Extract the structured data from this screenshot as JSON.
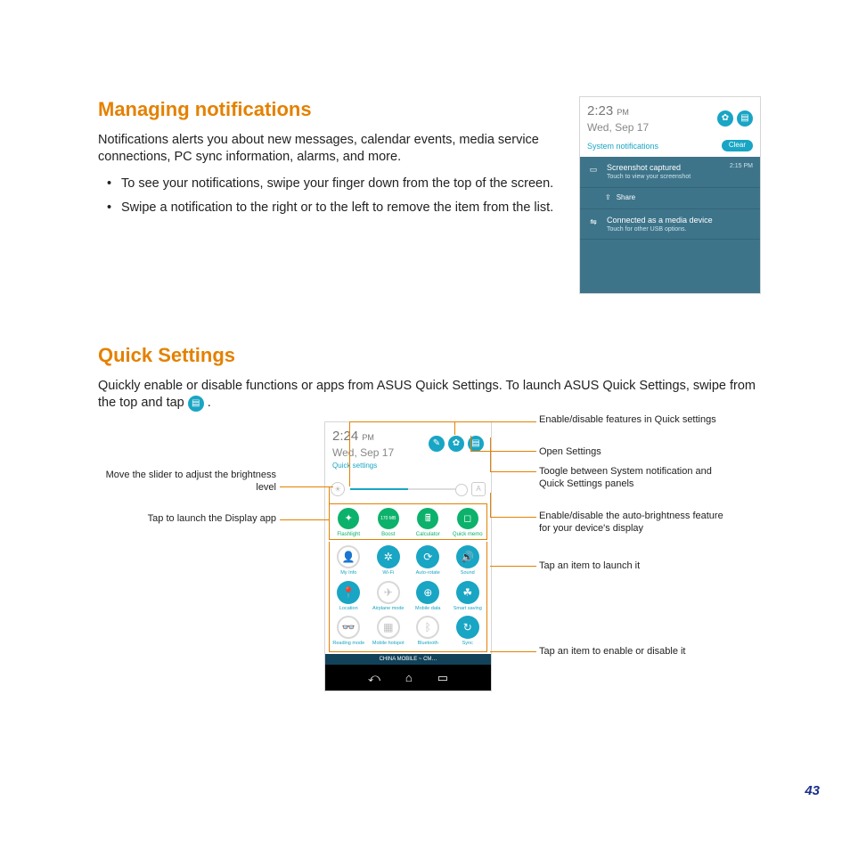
{
  "section1": {
    "heading": "Managing notifications",
    "intro": "Notifications alerts you about new messages, calendar events, media service connections, PC sync information, alarms, and more.",
    "bullets": [
      "To see your notifications, swipe your finger down from the top of the screen.",
      "Swipe a notification to the right or to the left to remove the item from the list."
    ]
  },
  "notif_panel": {
    "time": "2:23",
    "ampm": "PM",
    "date": "Wed, Sep 17",
    "sys_label": "System notifications",
    "clear": "Clear",
    "items": [
      {
        "icon": "picture-icon",
        "glyph": "▭",
        "title": "Screenshot captured",
        "sub": "Touch to view your screenshot",
        "rt": "2:15 PM"
      },
      {
        "icon": "share-icon",
        "glyph": "⇪",
        "title": "Share",
        "sub": "",
        "rt": ""
      },
      {
        "icon": "usb-icon",
        "glyph": "⇋",
        "title": "Connected as a media device",
        "sub": "Touch for other USB options.",
        "rt": ""
      }
    ]
  },
  "section2": {
    "heading": "Quick Settings",
    "intro_a": "Quickly enable or disable functions or apps from ASUS Quick Settings. To launch ASUS Quick Settings, swipe from the top and tap ",
    "intro_b": " ."
  },
  "qs_panel": {
    "time": "2:24",
    "ampm": "PM",
    "date": "Wed, Sep 17",
    "title": "Quick settings",
    "launch": [
      {
        "name": "flashlight-icon",
        "glyph": "✦",
        "label": "Flashlight"
      },
      {
        "name": "boost-icon",
        "glyph": "170 MB",
        "label": "Boost",
        "small": true
      },
      {
        "name": "calculator-icon",
        "glyph": "🖩",
        "label": "Calculator"
      },
      {
        "name": "quickmemo-icon",
        "glyph": "◻",
        "label": "Quick memo"
      }
    ],
    "toggles": [
      {
        "name": "myinfo-icon",
        "glyph": "👤",
        "label": "My Info",
        "on": false
      },
      {
        "name": "wifi-icon",
        "glyph": "✲",
        "label": "Wi-Fi",
        "on": true
      },
      {
        "name": "autorotate-icon",
        "glyph": "⟳",
        "label": "Auto-rotate",
        "on": true
      },
      {
        "name": "sound-icon",
        "glyph": "🔊",
        "label": "Sound",
        "on": true
      },
      {
        "name": "location-icon",
        "glyph": "📍",
        "label": "Location",
        "on": true
      },
      {
        "name": "airplane-icon",
        "glyph": "✈",
        "label": "Airplane mode",
        "on": false
      },
      {
        "name": "mobiledata-icon",
        "glyph": "⊕",
        "label": "Mobile data",
        "on": true
      },
      {
        "name": "smartsaving-icon",
        "glyph": "☘",
        "label": "Smart saving",
        "on": true
      },
      {
        "name": "readingmode-icon",
        "glyph": "👓",
        "label": "Reading mode",
        "on": false
      },
      {
        "name": "hotspot-icon",
        "glyph": "▦",
        "label": "Mobile hotspot",
        "on": false
      },
      {
        "name": "bluetooth-icon",
        "glyph": "ᛒ",
        "label": "Bluetooth",
        "on": false
      },
      {
        "name": "sync-icon",
        "glyph": "↻",
        "label": "Sync",
        "on": true
      }
    ],
    "carrier": "CHINA  MOBILE ~ CM…",
    "header_icons": [
      {
        "name": "edit-icon",
        "glyph": "✎"
      },
      {
        "name": "settings-gear-icon",
        "glyph": "✿"
      },
      {
        "name": "panel-toggle-icon",
        "glyph": "▤"
      }
    ]
  },
  "callouts": {
    "left_brightness": "Move the slider to adjust the brightness level",
    "left_display": "Tap to launch the Display app",
    "right_enable_features": "Enable/disable features in Quick settings",
    "right_open_settings": "Open Settings",
    "right_toggle_panels": "Toogle between System notification and Quick Settings panels",
    "right_auto_bright": "Enable/disable the auto-brightness feature for your device's display",
    "right_launch": "Tap an item to launch it",
    "right_toggle": "Tap an item to enable or disable it"
  },
  "page_number": "43"
}
